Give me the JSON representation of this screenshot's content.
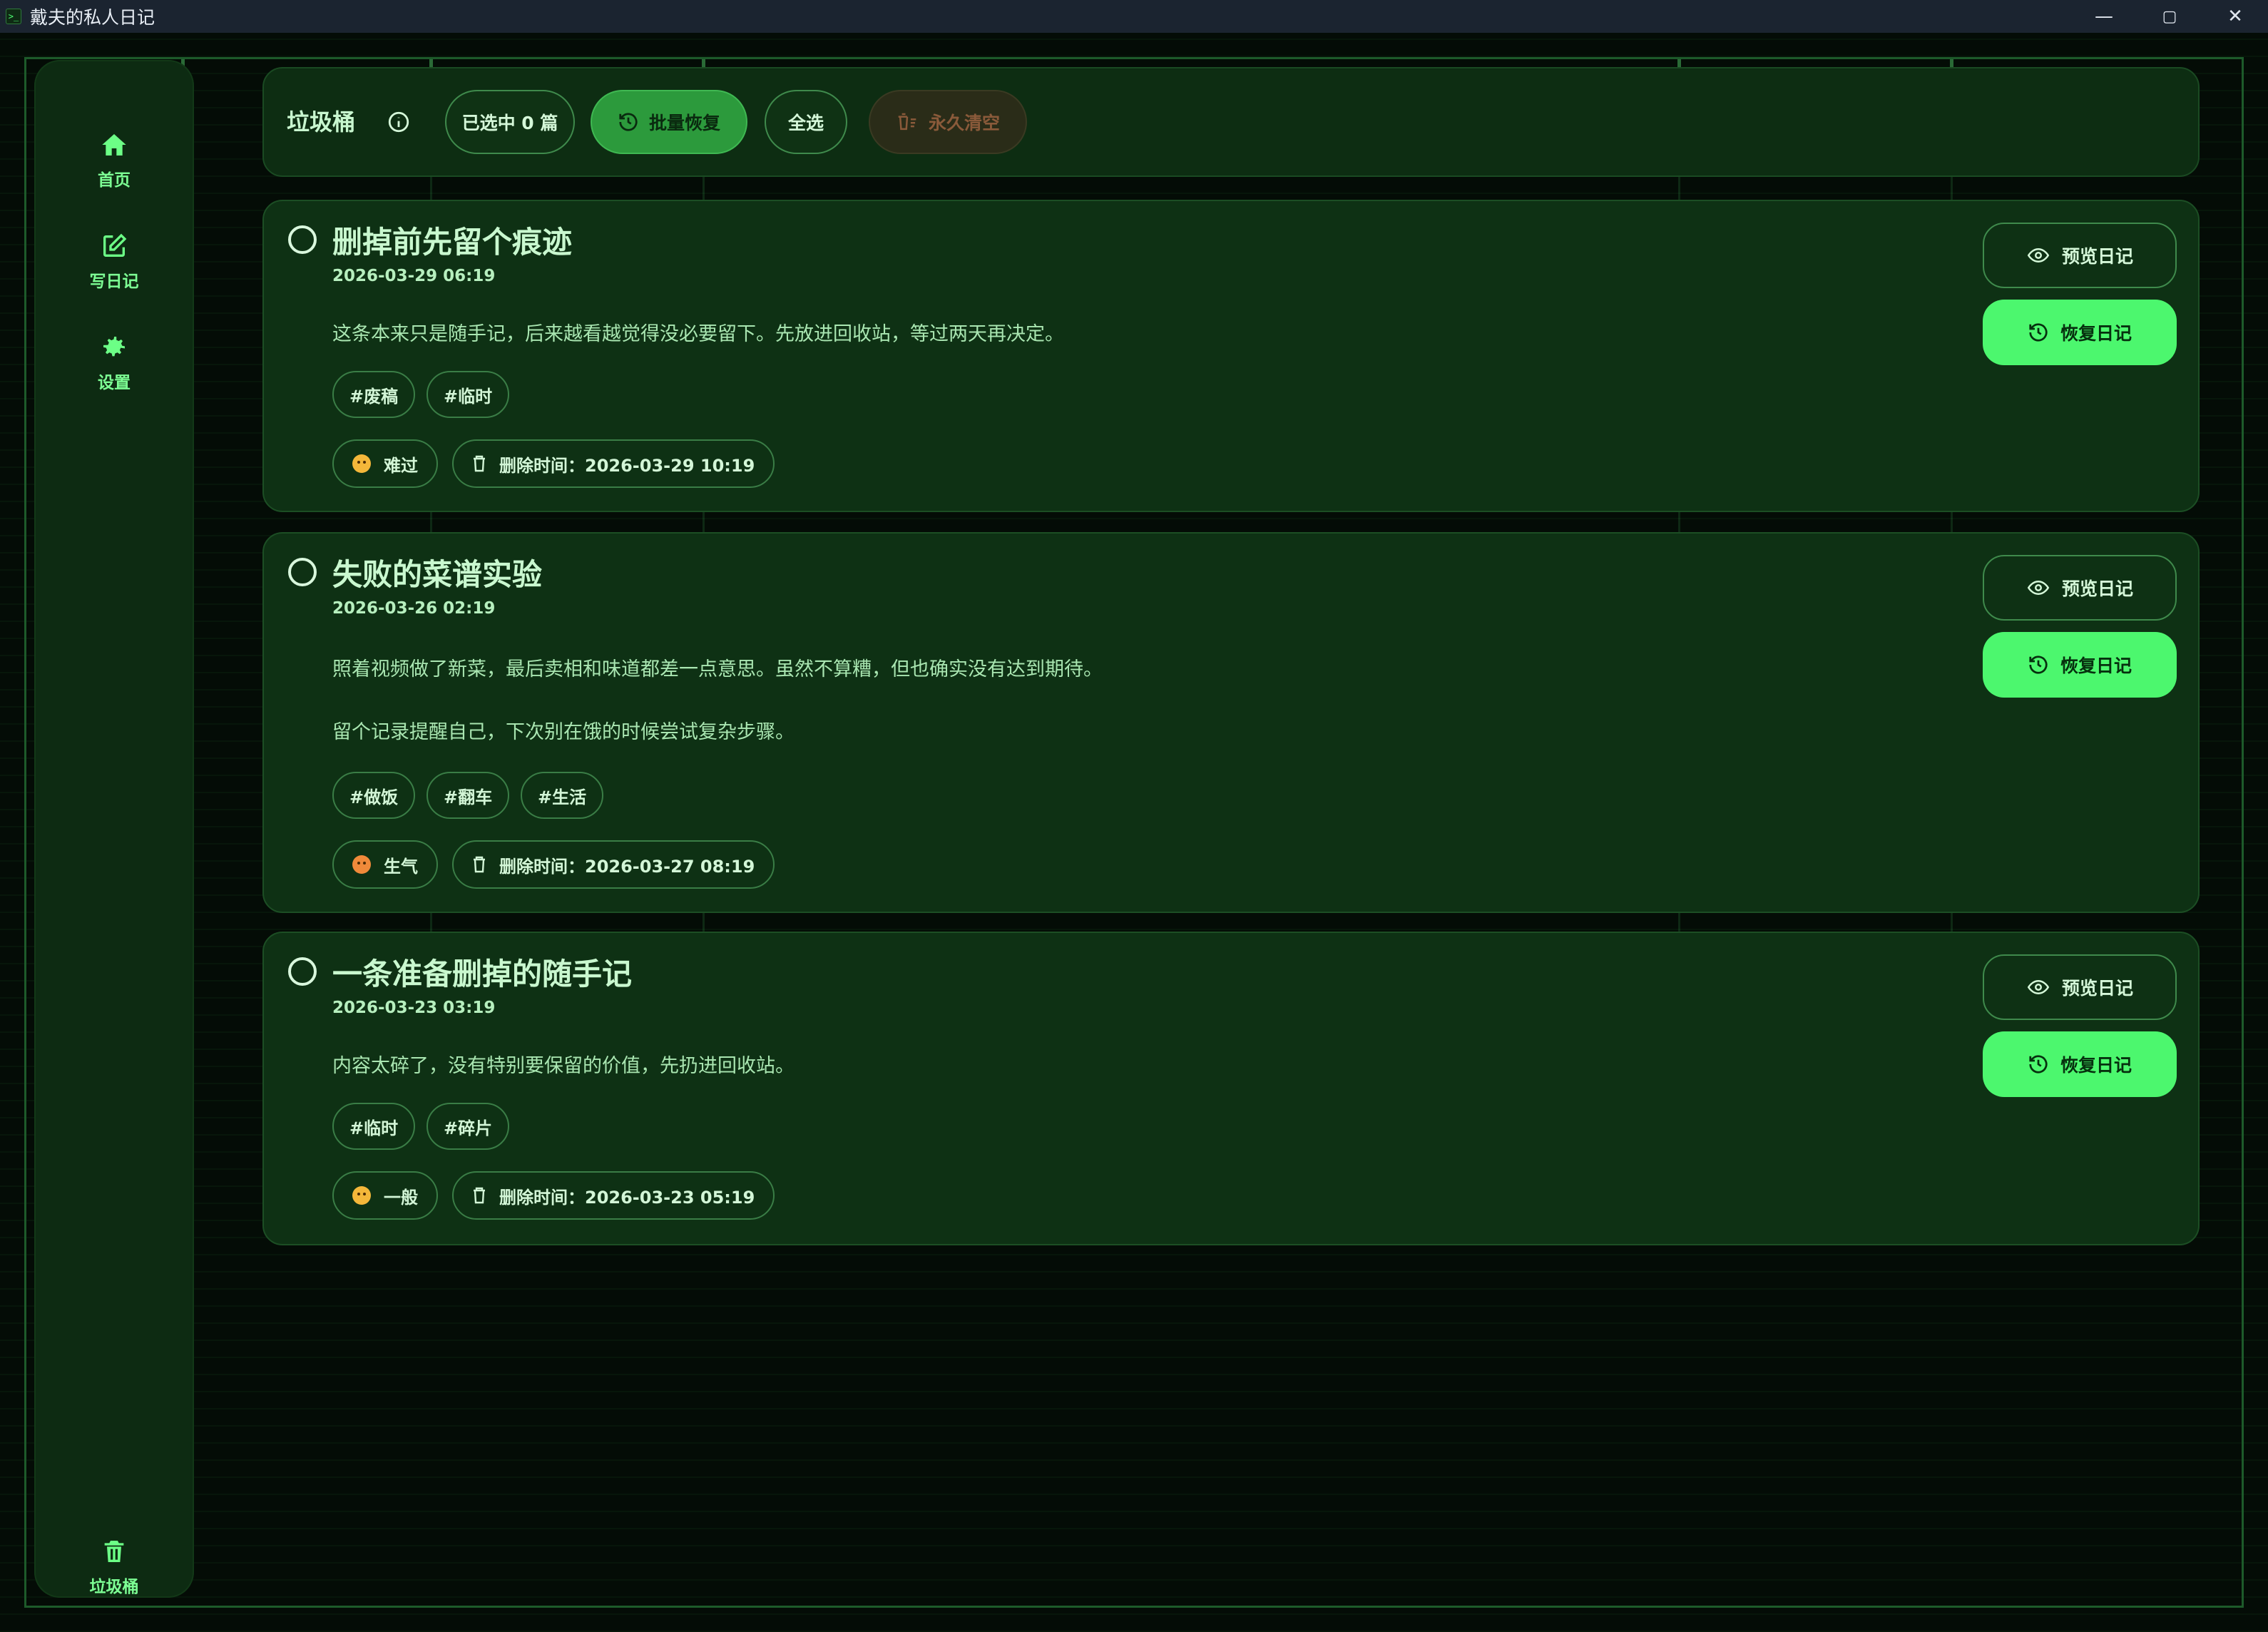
{
  "window": {
    "title": "戴夫的私人日记",
    "controls": [
      "—",
      "▢",
      "✕"
    ]
  },
  "sidebar": {
    "items": [
      {
        "label": "首页",
        "icon": "home-icon"
      },
      {
        "label": "写日记",
        "icon": "edit-icon"
      },
      {
        "label": "设置",
        "icon": "gear-icon"
      }
    ],
    "bottom_item": {
      "label": "垃圾桶",
      "icon": "trash-icon"
    }
  },
  "toolbar": {
    "title": "垃圾桶",
    "selected_label": "已选中 0 篇",
    "batch_restore_label": "批量恢复",
    "select_all_label": "全选",
    "empty_label": "永久清空"
  },
  "entries": [
    {
      "title": "删掉前先留个痕迹",
      "date": "2026-03-29 06:19",
      "body": [
        "这条本来只是随手记，后来越看越觉得没必要留下。先放进回收站，等过两天再决定。"
      ],
      "tags": [
        "#废稿",
        "#临时"
      ],
      "mood": "难过",
      "deleted_at": "删除时间：2026-03-29 10:19"
    },
    {
      "title": "失败的菜谱实验",
      "date": "2026-03-26 02:19",
      "body": [
        "照着视频做了新菜，最后卖相和味道都差一点意思。虽然不算糟，但也确实没有达到期待。",
        "留个记录提醒自己，下次别在饿的时候尝试复杂步骤。"
      ],
      "tags": [
        "#做饭",
        "#翻车",
        "#生活"
      ],
      "mood": "生气",
      "deleted_at": "删除时间：2026-03-27 08:19"
    },
    {
      "title": "一条准备删掉的随手记",
      "date": "2026-03-23 03:19",
      "body": [
        "内容太碎了，没有特别要保留的价值，先扔进回收站。"
      ],
      "tags": [
        "#临时",
        "#碎片"
      ],
      "mood": "一般",
      "deleted_at": "删除时间：2026-03-23 05:19"
    }
  ],
  "card_actions": {
    "preview_label": "预览日记",
    "restore_label": "恢复日记"
  },
  "colors": {
    "accent": "#4cf76e",
    "card_bg": "#0e3114",
    "page_bg": "#040c06"
  }
}
